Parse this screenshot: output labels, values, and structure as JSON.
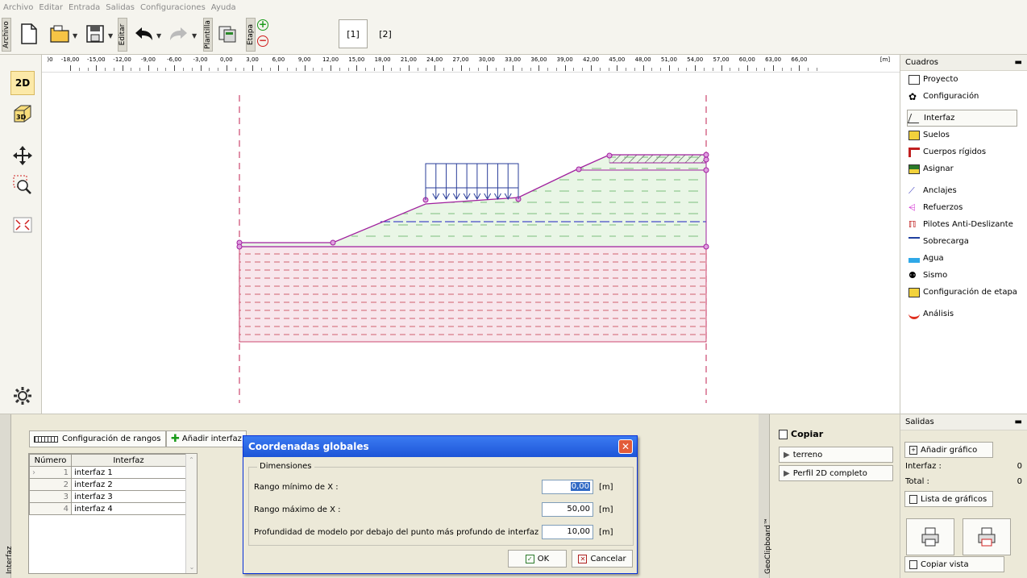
{
  "menu": [
    "Archivo",
    "Editar",
    "Entrada",
    "Salidas",
    "Configuraciones",
    "Ayuda"
  ],
  "toolbar": {
    "archivo_label": "Archivo",
    "editar_label": "Editar",
    "plantilla_label": "Plantilla",
    "etapa_label": "Etapa",
    "stages": [
      "[1]",
      "[2]"
    ]
  },
  "lefttools": {
    "mode_2d": "2D",
    "mode_3d": "3D"
  },
  "ruler": {
    "ticks": [
      "-18,00",
      "-15,00",
      "-12,00",
      "-9,00",
      "-6,00",
      "-3,00",
      "0,00",
      "3,00",
      "6,00",
      "9,00",
      "12,00",
      "15,00",
      "18,00",
      "21,00",
      "24,00",
      "27,00",
      "30,00",
      "33,00",
      "36,00",
      "39,00",
      "42,00",
      "45,00",
      "48,00",
      "51,00",
      "54,00",
      "57,00",
      "60,00",
      "63,00",
      "66,00"
    ],
    "unit": "[m]"
  },
  "cuadros": {
    "title": "Cuadros",
    "items": [
      "Proyecto",
      "Configuración",
      "Interfaz",
      "Suelos",
      "Cuerpos rígidos",
      "Asignar",
      "Anclajes",
      "Refuerzos",
      "Pilotes Anti-Deslizante",
      "Sobrecarga",
      "Agua",
      "Sismo",
      "Configuración de etapa",
      "Análisis"
    ]
  },
  "bottom": {
    "tab_label": "Interfaz",
    "config_ranges": "Configuración de rangos",
    "add_interface": "Añadir interfaz",
    "table": {
      "headers": [
        "Número",
        "Interfaz"
      ],
      "rows": [
        {
          "num": "1",
          "name": "interfaz 1"
        },
        {
          "num": "2",
          "name": "interfaz 2"
        },
        {
          "num": "3",
          "name": "interfaz 3"
        },
        {
          "num": "4",
          "name": "interfaz 4"
        }
      ]
    }
  },
  "dialog": {
    "title": "Coordenadas globales",
    "group": "Dimensiones",
    "fields": [
      {
        "label": "Rango mínimo de X :",
        "value": "0,00",
        "unit": "[m]"
      },
      {
        "label": "Rango máximo de X :",
        "value": "50,00",
        "unit": "[m]"
      },
      {
        "label": "Profundidad de modelo por debajo del punto más profundo de interfaz :",
        "value": "10,00",
        "unit": "[m]"
      }
    ],
    "ok": "OK",
    "cancel": "Cancelar"
  },
  "clipboard": {
    "tab_label": "GeoClipboard™",
    "copy": "Copiar",
    "terreno": "terreno",
    "perfil": "Perfil 2D completo"
  },
  "salidas": {
    "title": "Salidas",
    "add_graph": "Añadir gráfico",
    "interfaz_label": "Interfaz :",
    "interfaz_count": "0",
    "total_label": "Total :",
    "total_count": "0",
    "list_graphs": "Lista de gráficos",
    "copy_view": "Copiar vista"
  },
  "colors": {
    "soil_upper": "#e8f5e8",
    "soil_lower": "#f5e6ea",
    "interface": "#a0209e",
    "water": "#2020c0"
  }
}
